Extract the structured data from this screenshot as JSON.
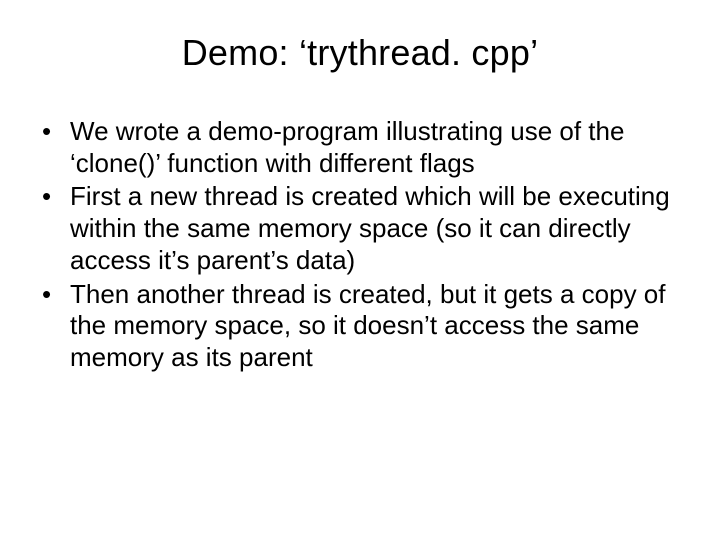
{
  "slide": {
    "title": "Demo: ‘trythread. cpp’",
    "bullets": [
      "We wrote a demo-program illustrating use of the ‘clone()’ function with different flags",
      "First a new thread is created which will be executing within the same memory space (so it can directly access it’s parent’s data)",
      "Then another thread is created, but it gets a copy of the memory space, so it doesn’t access the same memory as its parent"
    ]
  }
}
